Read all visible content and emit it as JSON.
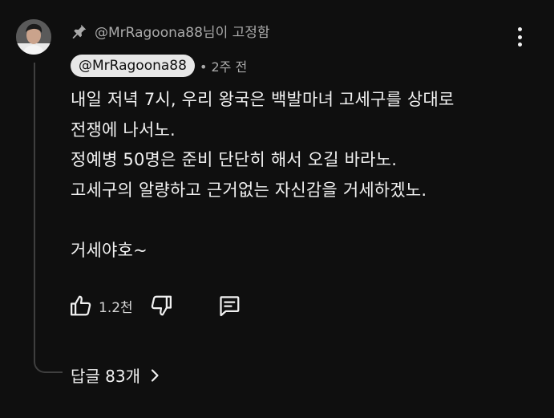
{
  "comment": {
    "pinned_label": "@MrRagoona88님이 고정함",
    "author": "@MrRagoona88",
    "timestamp": "• 2주 전",
    "lines": [
      "내일 저녁 7시, 우리 왕국은 백발마녀 고세구를 상대로",
      "전쟁에 나서노.",
      "정예병 50명은 준비 단단히 해서 오길 바라노.",
      "고세구의 알량하고 근거없는 자신감을 거세하겠노.",
      "",
      "거세야호~"
    ],
    "like_count": "1.2천",
    "replies_label": "답글 83개"
  },
  "icons": {
    "pin": "pin-icon",
    "more": "more-vertical-icon",
    "like": "thumbs-up-icon",
    "dislike": "thumbs-down-icon",
    "reply": "comment-reply-icon",
    "chevron": "chevron-right-icon"
  },
  "colors": {
    "background": "#0f0f0f",
    "text": "#f1f1f1",
    "secondary_text": "#aaaaaa",
    "author_chip_bg": "#e7e7e7",
    "thread_line": "#3f3f3f"
  }
}
